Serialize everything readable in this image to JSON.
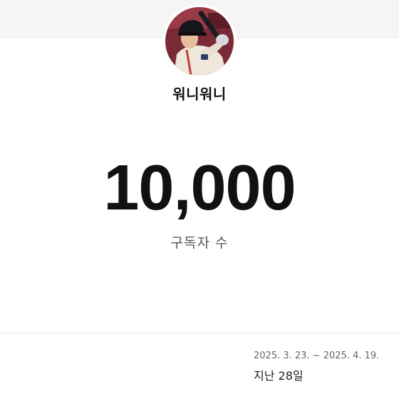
{
  "profile": {
    "avatar_icon": "baseball-player-photo",
    "channel_name": "워니워니"
  },
  "stats": {
    "subscriber_count": "10,000",
    "subscriber_label": "구독자 수"
  },
  "footer": {
    "date_range": "2025. 3. 23. ~ 2025. 4. 19.",
    "period": "지난 28일"
  },
  "colors": {
    "top_band": "#f5f5f5",
    "text_primary": "#111111",
    "text_secondary": "#555555",
    "divider": "#e3e3e3"
  }
}
